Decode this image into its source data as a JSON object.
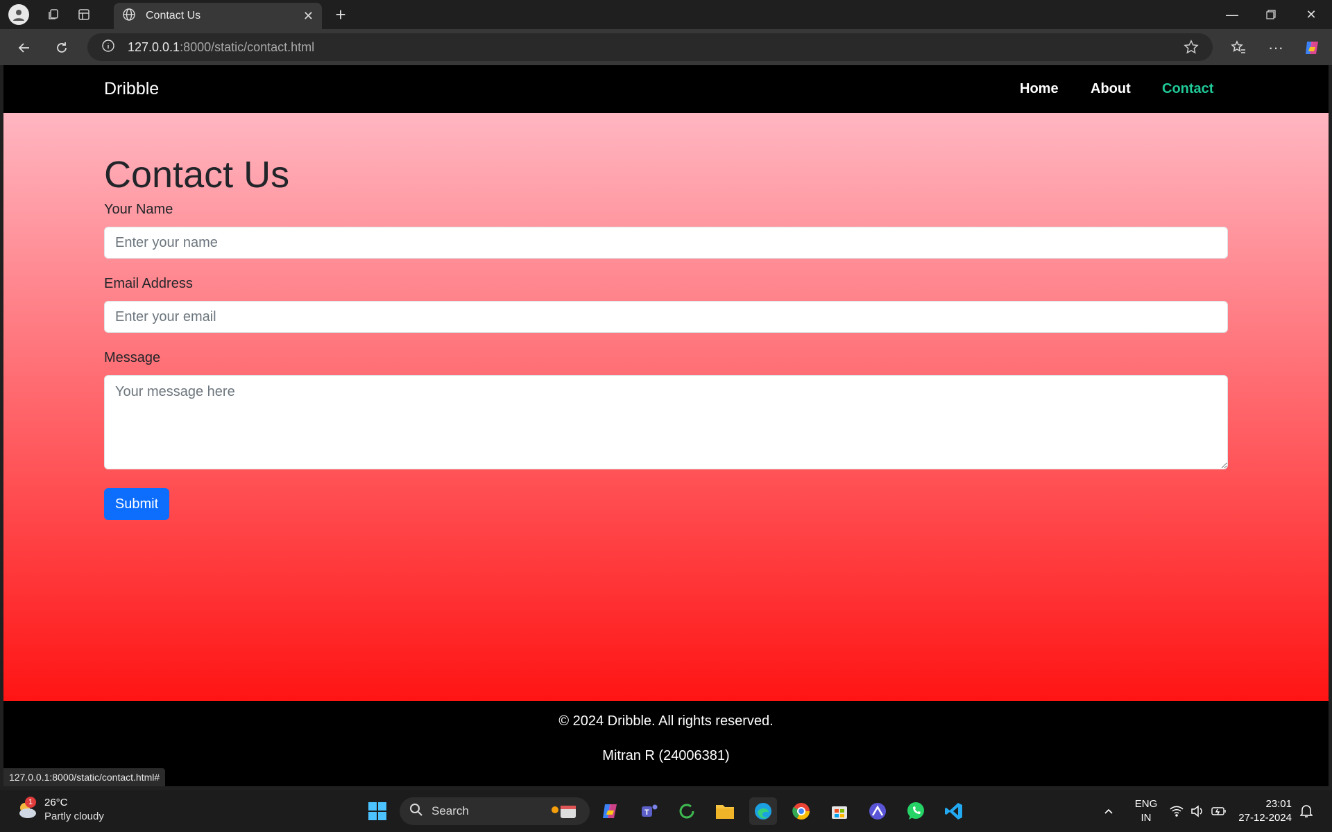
{
  "browser": {
    "tab_title": "Contact Us",
    "url_host": "127.0.0.1",
    "url_rest": ":8000/static/contact.html",
    "status_url": "127.0.0.1:8000/static/contact.html#"
  },
  "site": {
    "brand": "Dribble",
    "nav": [
      {
        "label": "Home",
        "active": false
      },
      {
        "label": "About",
        "active": false
      },
      {
        "label": "Contact",
        "active": true
      }
    ],
    "active_color": "#20c997"
  },
  "contact": {
    "title": "Contact Us",
    "name_label": "Your Name",
    "name_placeholder": "Enter your name",
    "email_label": "Email Address",
    "email_placeholder": "Enter your email",
    "message_label": "Message",
    "message_placeholder": "Your message here",
    "submit_label": "Submit",
    "gradient_top": "#ffb6c1",
    "gradient_bottom": "#ff1414",
    "submit_color": "#0d6efd"
  },
  "footer": {
    "copyright": "© 2024 Dribble. All rights reserved.",
    "author": "Mitran R (24006381)"
  },
  "taskbar": {
    "weather_temp": "26°C",
    "weather_desc": "Partly cloudy",
    "weather_badge": "1",
    "search_label": "Search",
    "lang_line1": "ENG",
    "lang_line2": "IN",
    "time": "23:01",
    "date": "27-12-2024",
    "apps": [
      "windows-start-icon",
      "copilot-icon",
      "teams-icon",
      "refresh-circle-icon",
      "file-explorer-icon",
      "edge-icon",
      "chrome-icon",
      "store-icon",
      "app-icon",
      "whatsapp-icon",
      "vscode-icon"
    ]
  }
}
